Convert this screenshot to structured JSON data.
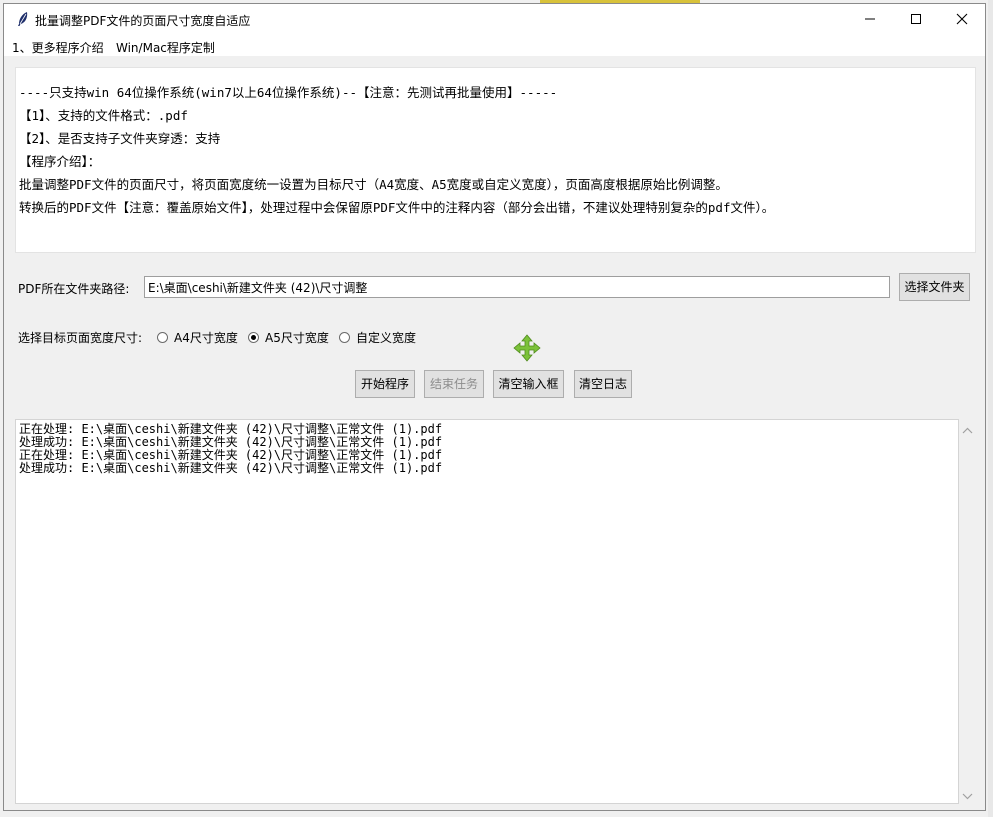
{
  "window": {
    "title": "批量调整PDF文件的页面尺寸宽度自适应"
  },
  "menu": {
    "items": [
      "1、更多程序介绍",
      "Win/Mac程序定制"
    ]
  },
  "info": {
    "lines": [
      "----只支持win 64位操作系统(win7以上64位操作系统)--【注意：先测试再批量使用】-----",
      "【1】、支持的文件格式：.pdf",
      "【2】、是否支持子文件夹穿透：支持",
      "【程序介绍】：",
      "批量调整PDF文件的页面尺寸，将页面宽度统一设置为目标尺寸（A4宽度、A5宽度或自定义宽度），页面高度根据原始比例调整。",
      "转换后的PDF文件【注意：覆盖原始文件】，处理过程中会保留原PDF文件中的注释内容（部分会出错，不建议处理特别复杂的pdf文件）。"
    ]
  },
  "folder": {
    "label": "PDF所在文件夹路径:",
    "value": "E:\\桌面\\ceshi\\新建文件夹 (42)\\尺寸调整",
    "browse_label": "选择文件夹"
  },
  "size_select": {
    "label": "选择目标页面宽度尺寸:",
    "options": [
      "A4尺寸宽度",
      "A5尺寸宽度",
      "自定义宽度"
    ],
    "selected": "A5尺寸宽度"
  },
  "actions": {
    "start": "开始程序",
    "stop": "结束任务",
    "clear_input": "清空输入框",
    "clear_log": "清空日志"
  },
  "log": {
    "lines": [
      "正在处理: E:\\桌面\\ceshi\\新建文件夹 (42)\\尺寸调整\\正常文件 (1).pdf",
      "处理成功: E:\\桌面\\ceshi\\新建文件夹 (42)\\尺寸调整\\正常文件 (1).pdf",
      "正在处理: E:\\桌面\\ceshi\\新建文件夹 (42)\\尺寸调整\\正常文件 (1).pdf",
      "处理成功: E:\\桌面\\ceshi\\新建文件夹 (42)\\尺寸调整\\正常文件 (1).pdf"
    ]
  },
  "icons": {
    "app": "feather-icon",
    "minimize": "minimize-icon",
    "maximize": "maximize-icon",
    "close": "close-icon",
    "cursor": "move-cursor-icon"
  },
  "colors": {
    "move_icon": "#7cc23a"
  }
}
